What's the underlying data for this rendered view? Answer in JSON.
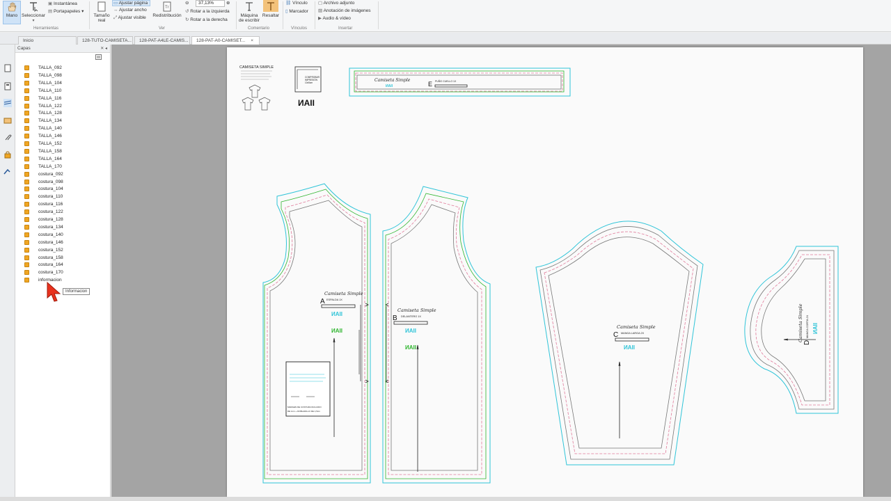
{
  "ribbon": {
    "mano": "Mano",
    "seleccionar": "Seleccionar",
    "instantanea": "Instantánea",
    "portapapeles": "Portapapeles",
    "herramientas": "Herramientas",
    "tamano_real_1": "Tamaño",
    "tamano_real_2": "real",
    "ajustar_pagina": "Ajustar página",
    "ajustar_ancho": "Ajustar ancho",
    "ajustar_visible": "Ajustar visible",
    "redistribucion": "Redistribución",
    "zoom": "37,13%",
    "rotar_izq": "Rotar a la izquierda",
    "rotar_der": "Rotar a la derecha",
    "ver": "Ver",
    "maquina_1": "Máquina",
    "maquina_2": "de escribir",
    "resaltar": "Resaltar",
    "comentario": "Comentario",
    "vinculo": "Vínculo",
    "marcador": "Marcador",
    "vinculos": "Vínculos",
    "archivo_adjunto": "Archivo adjunto",
    "anotacion_imagenes": "Anotación de imágenes",
    "audio_video": "Audio & vídeo",
    "insertar": "Insertar"
  },
  "tabs": [
    {
      "label": "Inicio"
    },
    {
      "label": "128-TUTO-CAMISETA..."
    },
    {
      "label": "128-PAT-A4LE-CAMIS..."
    },
    {
      "label": "128-PAT-A0-CAMISET..."
    }
  ],
  "tab_close": "×",
  "panel": {
    "title": "Capas",
    "controls": "✕ ◂",
    "layers": [
      "TALLA_092",
      "TALLA_098",
      "TALLA_104",
      "TALLA_110",
      "TALLA_116",
      "TALLA_122",
      "TALLA_128",
      "TALLA_134",
      "TALLA_140",
      "TALLA_146",
      "TALLA_152",
      "TALLA_158",
      "TALLA_164",
      "TALLA_170",
      "costura_092",
      "costura_098",
      "costura_104",
      "costura_110",
      "costura_116",
      "costura_122",
      "costura_128",
      "costura_134",
      "costura_140",
      "costura_146",
      "costura_152",
      "costura_158",
      "costura_164",
      "costura_170",
      "informacion"
    ],
    "tooltip": "Informacion"
  },
  "pattern": {
    "header_title": "CAMISETA SIMPLE",
    "brand": "ИAII",
    "print_note_1": "COMPROBAR",
    "print_note_2": "IMPRESIÓN",
    "print_note_3": "10x5cm",
    "piece_title": "Camiseta Simple",
    "piece_a_letter": "A",
    "piece_a_name": "ESPALDA 1X",
    "piece_b_letter": "B",
    "piece_b_name": "DELANTERO 1X",
    "piece_c_letter": "C",
    "piece_c_name": "MANGA LARGA 2X",
    "piece_d_letter": "D",
    "piece_d_name": "MANGA CORTA 2X",
    "piece_e_letter": "E",
    "piece_e_name": "PUÑO CUELLO 1X",
    "margin_note_1": "MARGEN DE COSTURA INCLUIDO",
    "margin_note_2": "DE 1cm + DOBLADILLO DE 1,5cm"
  },
  "colors": {
    "cyan": "#2fc4d8",
    "green": "#2fb52f",
    "pink": "#e07a9a",
    "orange": "#f0a623"
  }
}
